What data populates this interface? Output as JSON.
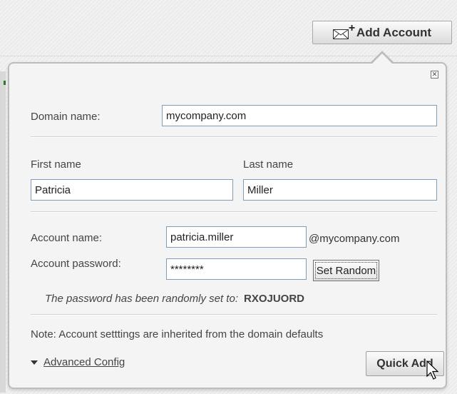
{
  "toolbar": {
    "add_account_label": "Add Account"
  },
  "form": {
    "domain": {
      "label": "Domain name:",
      "value": "mycompany.com"
    },
    "first_name": {
      "label": "First name",
      "value": "Patricia"
    },
    "last_name": {
      "label": "Last name",
      "value": "Miller"
    },
    "account_name": {
      "label": "Account name:",
      "value": "patricia.miller",
      "suffix": "@mycompany.com"
    },
    "account_password": {
      "label": "Account password:",
      "value": "********",
      "set_random_label": "Set Random"
    },
    "password_message": {
      "text": "The password has been randomly set to:",
      "value": "RXOJUORD"
    },
    "note": "Note: Account setttings are inherited from the domain defaults",
    "advanced_label": "Advanced Config",
    "quick_add_label": "Quick Add"
  },
  "colors": {
    "panel_bg": "#f4f4f4",
    "field_border": "#7f9db9",
    "edge_mark": "#2a7a2a"
  },
  "icons": [
    "mail-plus-icon",
    "close-icon",
    "expand-triangle-icon",
    "mouse-cursor-icon"
  ]
}
